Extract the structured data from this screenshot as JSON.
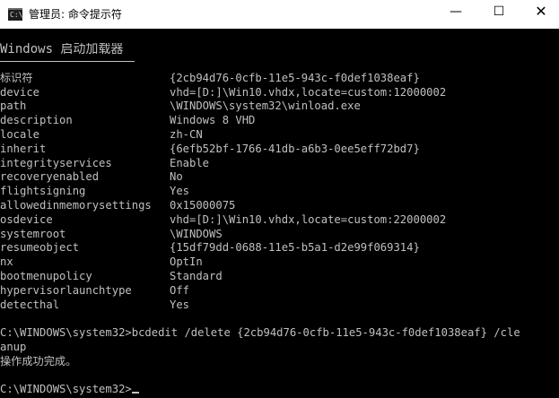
{
  "window": {
    "title": "管理员: 命令提示符",
    "icon": "console-icon",
    "icon_glyph": "C:\\",
    "buttons": {
      "minimize": "—",
      "maximize": "☐",
      "close": "✕"
    }
  },
  "console": {
    "heading": "Windows 启动加载器",
    "entries": [
      {
        "key": "标识符",
        "value": "{2cb94d76-0cfb-11e5-943c-f0def1038eaf}"
      },
      {
        "key": "device",
        "value": "vhd=[D:]\\Win10.vhdx,locate=custom:12000002"
      },
      {
        "key": "path",
        "value": "\\WINDOWS\\system32\\winload.exe"
      },
      {
        "key": "description",
        "value": "Windows 8 VHD"
      },
      {
        "key": "locale",
        "value": "zh-CN"
      },
      {
        "key": "inherit",
        "value": "{6efb52bf-1766-41db-a6b3-0ee5eff72bd7}"
      },
      {
        "key": "integrityservices",
        "value": "Enable"
      },
      {
        "key": "recoveryenabled",
        "value": "No"
      },
      {
        "key": "flightsigning",
        "value": "Yes"
      },
      {
        "key": "allowedinmemorysettings",
        "value": "0x15000075"
      },
      {
        "key": "osdevice",
        "value": "vhd=[D:]\\Win10.vhdx,locate=custom:22000002"
      },
      {
        "key": "systemroot",
        "value": "\\WINDOWS"
      },
      {
        "key": "resumeobject",
        "value": "{15df79dd-0688-11e5-b5a1-d2e99f069314}"
      },
      {
        "key": "nx",
        "value": "OptIn"
      },
      {
        "key": "bootmenupolicy",
        "value": "Standard"
      },
      {
        "key": "hypervisorlaunchtype",
        "value": "Off"
      },
      {
        "key": "detecthal",
        "value": "Yes"
      }
    ],
    "command_line_1": "C:\\WINDOWS\\system32>bcdedit /delete {2cb94d76-0cfb-11e5-943c-f0def1038eaf} /cle",
    "command_line_2": "anup",
    "result": "操作成功完成。",
    "prompt": "C:\\WINDOWS\\system32>"
  },
  "colors": {
    "background": "#000000",
    "text": "#c0c0c0",
    "titlebar": "#ffffff"
  }
}
